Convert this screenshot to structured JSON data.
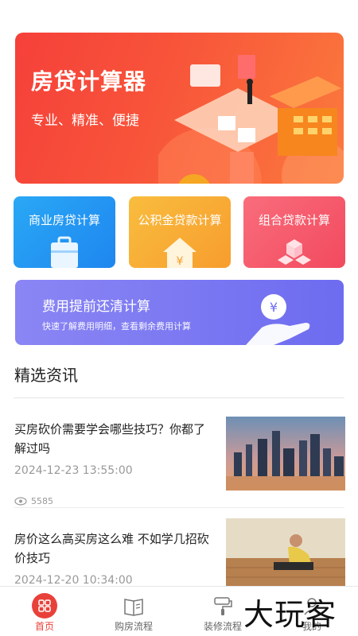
{
  "banner": {
    "title": "房贷计算器",
    "subtitle": "专业、精准、便捷"
  },
  "calculators": [
    {
      "label": "商业房贷计算",
      "icon": "briefcase-icon",
      "color": "#1e86f0"
    },
    {
      "label": "公积金贷款计算",
      "icon": "house-yen-icon",
      "color": "#f79d2e"
    },
    {
      "label": "组合贷款计算",
      "icon": "cubes-icon",
      "color": "#f24a5e"
    }
  ],
  "fee_calculator": {
    "title": "费用提前还清计算",
    "subtitle": "快速了解费用明细，查看剩余费用计算",
    "icon": "hand-yen-icon"
  },
  "news_section": {
    "title": "精选资讯",
    "items": [
      {
        "title": "买房砍价需要学会哪些技巧？你都了解过吗",
        "time": "2024-12-23 13:55:00",
        "views": "5585",
        "thumb": "city-skyline-image"
      },
      {
        "title": "房价这么高买房这么难 不如学几招砍价技巧",
        "time": "2024-12-20 10:34:00",
        "thumb": "floor-installation-image"
      }
    ]
  },
  "tabs": [
    {
      "label": "首页",
      "icon": "home-grid-icon",
      "active": true
    },
    {
      "label": "购房流程",
      "icon": "book-icon",
      "active": false
    },
    {
      "label": "装修流程",
      "icon": "paint-roller-icon",
      "active": false
    },
    {
      "label": "我的",
      "icon": "user-icon",
      "active": false
    }
  ],
  "brand_watermark": "大玩客",
  "colors": {
    "accent": "#e8413a",
    "banner": "#f5403a"
  }
}
